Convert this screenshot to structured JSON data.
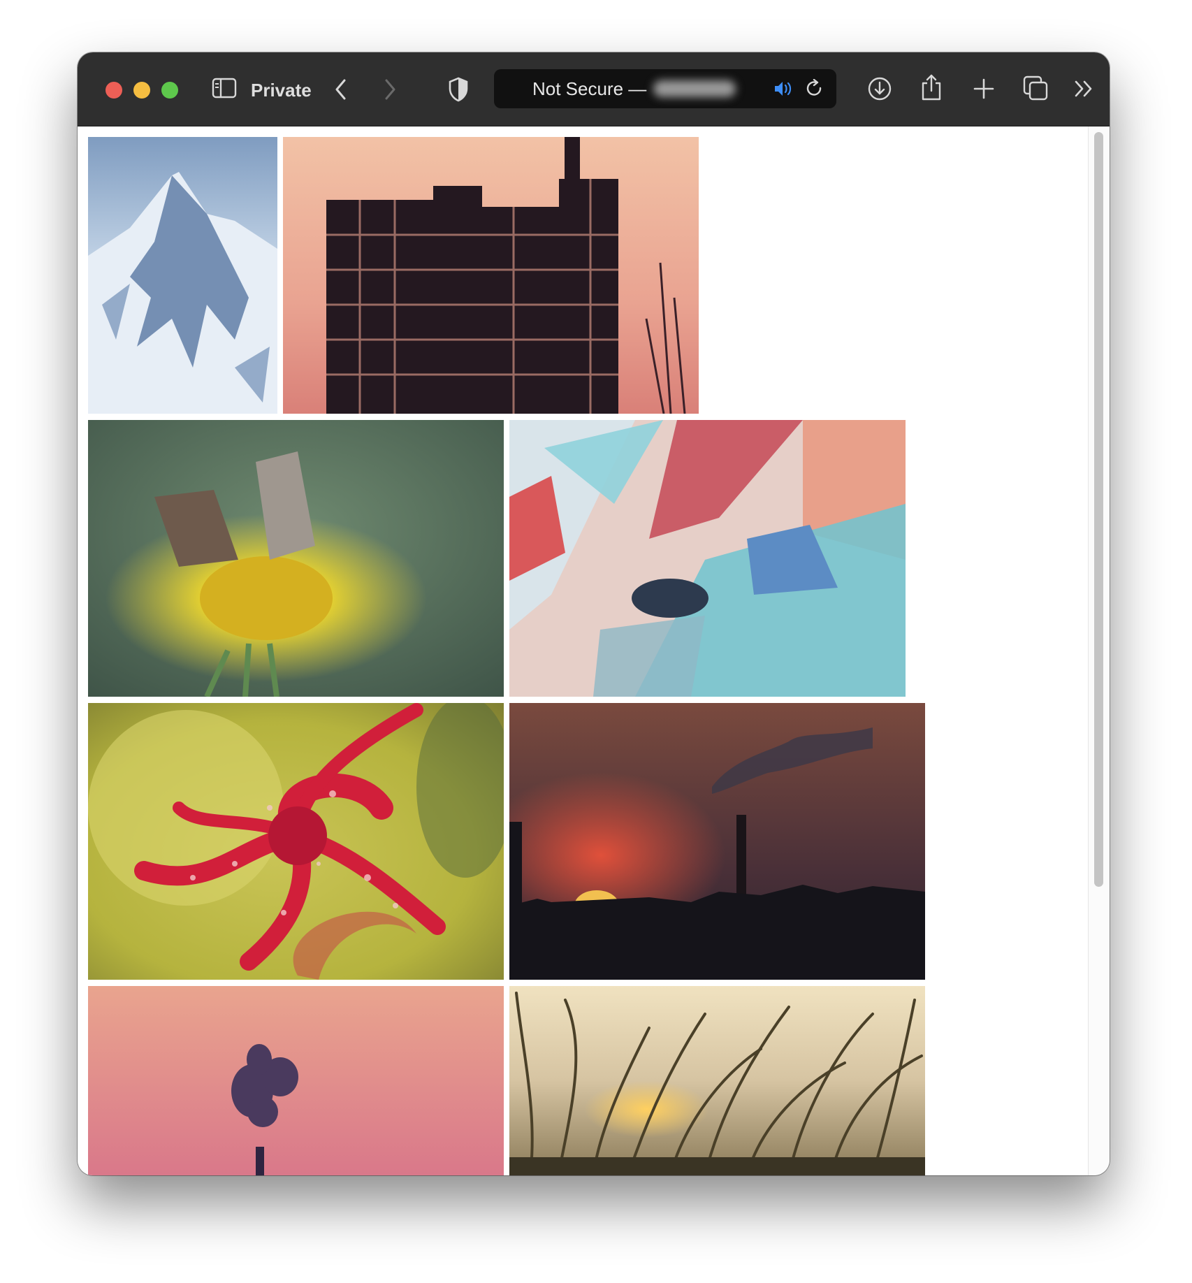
{
  "toolbar": {
    "private_label": "Private",
    "address_text": "Not Secure —",
    "icons": [
      "sidebar-icon",
      "back-icon",
      "forward-icon",
      "shield-icon",
      "speaker-icon",
      "reload-icon",
      "download-icon",
      "share-icon",
      "new-tab-icon",
      "tabs-overview-icon",
      "more-icon"
    ]
  },
  "gallery": {
    "photos": [
      {
        "subject": "mountain-painting"
      },
      {
        "subject": "building-scaffold-sunset"
      },
      {
        "subject": "butterflies-on-yellow-flower"
      },
      {
        "subject": "abstract-painting"
      },
      {
        "subject": "red-curled-plant-with-droplets"
      },
      {
        "subject": "sunset-smokestack"
      },
      {
        "subject": "pink-sky-smoke"
      },
      {
        "subject": "grass-sunset"
      }
    ]
  },
  "colors": {
    "toolbar_bg": "#2f2f2f",
    "close": "#ed5f56",
    "minimize": "#f5bd41",
    "zoom": "#5ec84c",
    "speaker": "#3e8ef7"
  }
}
